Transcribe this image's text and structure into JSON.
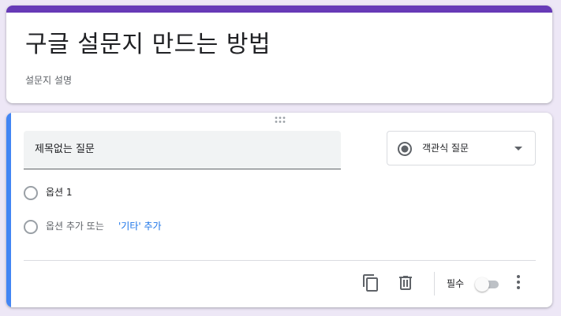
{
  "colors": {
    "page_bg": "#ede7f6",
    "accent_purple": "#673ab7",
    "focus_blue": "#4285f4",
    "link_blue": "#1a73e8"
  },
  "form": {
    "title": "구글 설문지 만드는 방법",
    "description": "설문지 설명"
  },
  "question": {
    "title": "제목없는 질문",
    "type_label": "객관식 질문",
    "type_icon": "radio-button-checked-icon",
    "options": [
      {
        "label": "옵션 1"
      }
    ],
    "add_option_text": "옵션 추가 또는",
    "add_other_link": "'기타' 추가",
    "required_label": "필수",
    "required_on": false
  },
  "toolbar": {
    "copy_icon": "copy-icon",
    "delete_icon": "trash-icon",
    "more_icon": "more-vert-icon"
  }
}
